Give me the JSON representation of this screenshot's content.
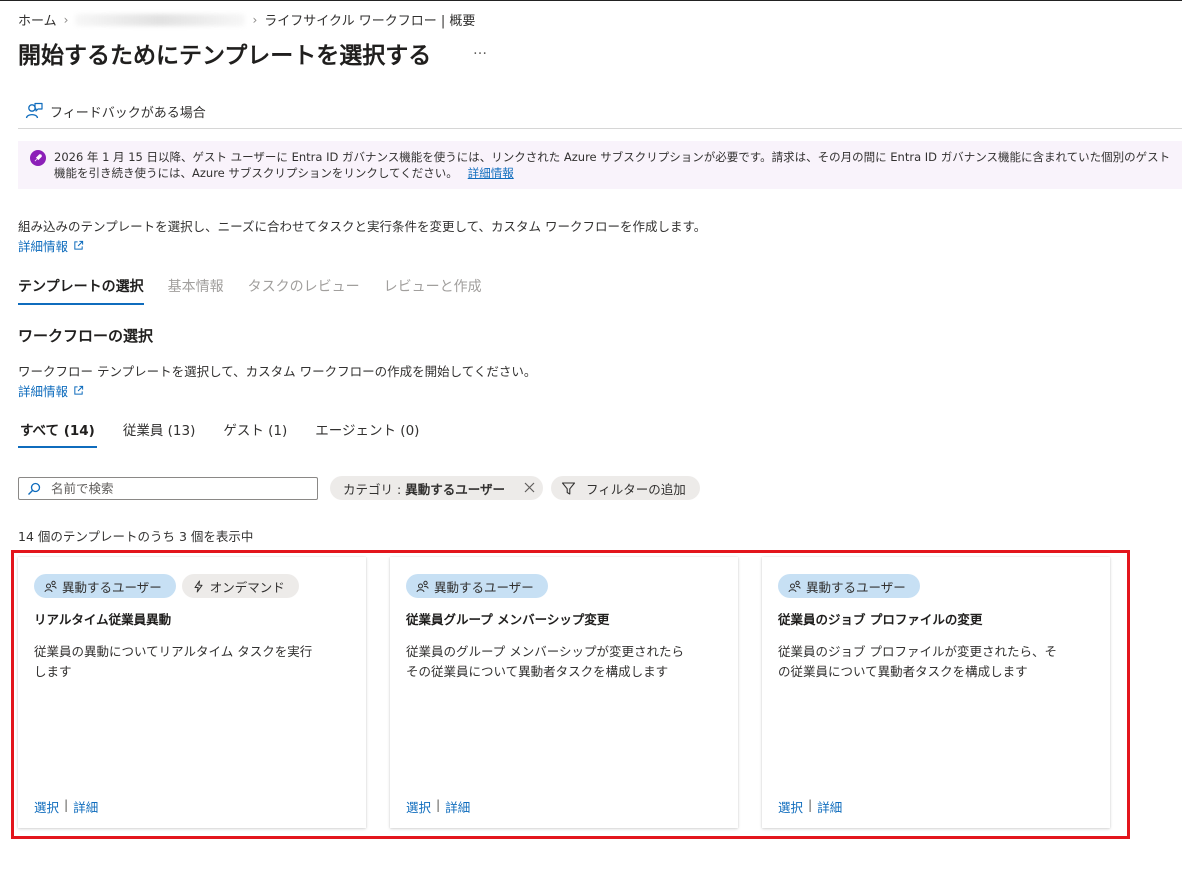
{
  "breadcrumb": {
    "home": "ホーム",
    "hidden": "████████",
    "current": "ライフサイクル ワークフロー | 概要"
  },
  "page": {
    "title": "開始するためにテンプレートを選択する",
    "more": "…"
  },
  "commandbar": {
    "feedback_label": "フィードバックがある場合"
  },
  "banner": {
    "line1": "2026 年 1 月 15 日以降、ゲスト ユーザーに Entra ID ガバナンス機能を使うには、リンクされた Azure サブスクリプションが必要です。請求は、その月の間に Entra ID ガバナンス機能に含まれていた個別のゲスト",
    "line2": "機能を引き続き使うには、Azure サブスクリプションをリンクしてください。",
    "link": "詳細情報"
  },
  "intro": {
    "text": "組み込みのテンプレートを選択し、ニーズに合わせてタスクと実行条件を変更して、カスタム ワークフローを作成します。",
    "learn_more": "詳細情報"
  },
  "wizard_tabs": [
    "テンプレートの選択",
    "基本情報",
    "タスクのレビュー",
    "レビューと作成"
  ],
  "section": {
    "title": "ワークフローの選択",
    "text": "ワークフロー テンプレートを選択して、カスタム ワークフローの作成を開始してください。",
    "learn_more": "詳細情報"
  },
  "pivots": [
    "すべて (14)",
    "従業員 (13)",
    "ゲスト (1)",
    "エージェント (0)"
  ],
  "search": {
    "placeholder": "名前で検索",
    "value": ""
  },
  "filters": {
    "category_prefix": "カテゴリ :",
    "category_value": "異動するユーザー",
    "add_filter": "フィルターの追加"
  },
  "result_count": "14 個のテンプレートのうち 3 個を表示中",
  "cards": [
    {
      "tag_user": "異動するユーザー",
      "tag_ondemand": "オンデマンド",
      "title": "リアルタイム従業員異動",
      "desc_line1": "従業員の異動についてリアルタイム タスクを実行",
      "desc_line2": "します",
      "select": "選択",
      "details": "詳細"
    },
    {
      "tag_user": "異動するユーザー",
      "title": "従業員グループ メンバーシップ変更",
      "desc_line1": "従業員のグループ メンバーシップが変更されたら",
      "desc_line2": "その従業員について異動者タスクを構成します",
      "select": "選択",
      "details": "詳細"
    },
    {
      "tag_user": "異動するユーザー",
      "title": "従業員のジョブ プロファイルの変更",
      "desc_line1": "従業員のジョブ プロファイルが変更されたら、そ",
      "desc_line2": "の従業員について異動者タスクを構成します",
      "select": "選択",
      "details": "詳細"
    }
  ],
  "link_separator": "|",
  "colors": {
    "accent": "#0f6cbd",
    "highlight_border": "#e3151c",
    "tag_user_bg": "#c7e0f4",
    "banner_bg": "#f9f3fb",
    "banner_icon": "#8c1fb8"
  }
}
